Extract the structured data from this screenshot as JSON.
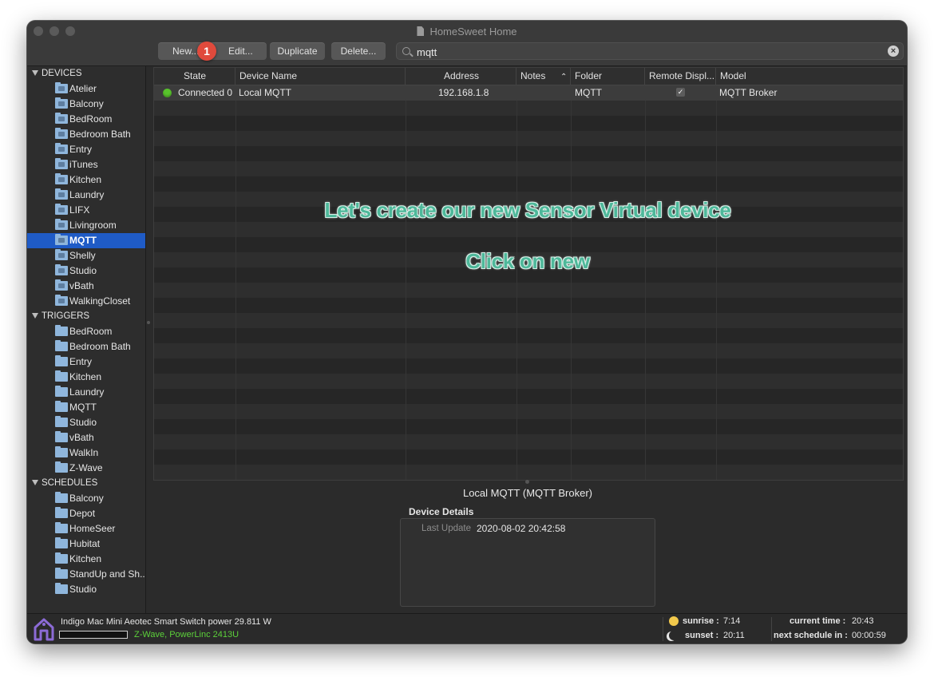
{
  "window": {
    "title": "HomeSweet Home"
  },
  "toolbar": {
    "new_label": "New...",
    "edit_label": "Edit...",
    "duplicate_label": "Duplicate",
    "delete_label": "Delete...",
    "step_badge": "1"
  },
  "search": {
    "value": "mqtt",
    "clear": "×"
  },
  "sidebar": {
    "devices_header": "DEVICES",
    "devices": [
      "Atelier",
      "Balcony",
      "BedRoom",
      "Bedroom Bath",
      "Entry",
      "iTunes",
      "Kitchen",
      "Laundry",
      "LIFX",
      "Livingroom",
      "MQTT",
      "Shelly",
      "Studio",
      "vBath",
      "WalkingCloset"
    ],
    "selected_device": "MQTT",
    "triggers_header": "TRIGGERS",
    "triggers": [
      "BedRoom",
      "Bedroom Bath",
      "Entry",
      "Kitchen",
      "Laundry",
      "MQTT",
      "Studio",
      "vBath",
      "WalkIn",
      "Z-Wave"
    ],
    "schedules_header": "SCHEDULES",
    "schedules": [
      "Balcony",
      "Depot",
      "HomeSeer",
      "Hubitat",
      "Kitchen",
      "StandUp and Sh...",
      "Studio"
    ],
    "add_icon": "+",
    "gear_icon": "⚙⌄"
  },
  "table": {
    "columns": [
      "State",
      "Device Name",
      "Address",
      "Notes",
      "Folder",
      "Remote Displ...",
      "Model"
    ],
    "sort_indicator": "⌃",
    "rows": [
      {
        "state": "Connected 0",
        "name": "Local MQTT",
        "address": "192.168.1.8",
        "notes": "",
        "folder": "MQTT",
        "remote": "✓",
        "model": "MQTT Broker"
      }
    ]
  },
  "overlay": {
    "line1": "Let's create our new Sensor Virtual device",
    "line2": "Click on new"
  },
  "details": {
    "title": "Local MQTT (MQTT Broker)",
    "section_label": "Device Details",
    "last_update_label": "Last Update",
    "last_update_value": "2020-08-02 20:42:58"
  },
  "statusbar": {
    "message": "Indigo Mac Mini Aeotec Smart Switch power 29.811 W",
    "interface_1": "Z-Wave",
    "interface_sep": ", ",
    "interface_2": "PowerLinc 2413U",
    "sunrise_label": "sunrise :",
    "sunrise_value": "7:14",
    "sunset_label": "sunset :",
    "sunset_value": "20:11",
    "current_time_label": "current time :",
    "current_time_value": "20:43",
    "next_schedule_label": "next schedule in :",
    "next_schedule_value": "00:00:59"
  },
  "colors": {
    "accent_selection": "#1f5bc6",
    "badge": "#e04a3c",
    "connected": "#58c22c",
    "interface_text": "#5cd13a",
    "overlay_text": "#4eb89a"
  }
}
